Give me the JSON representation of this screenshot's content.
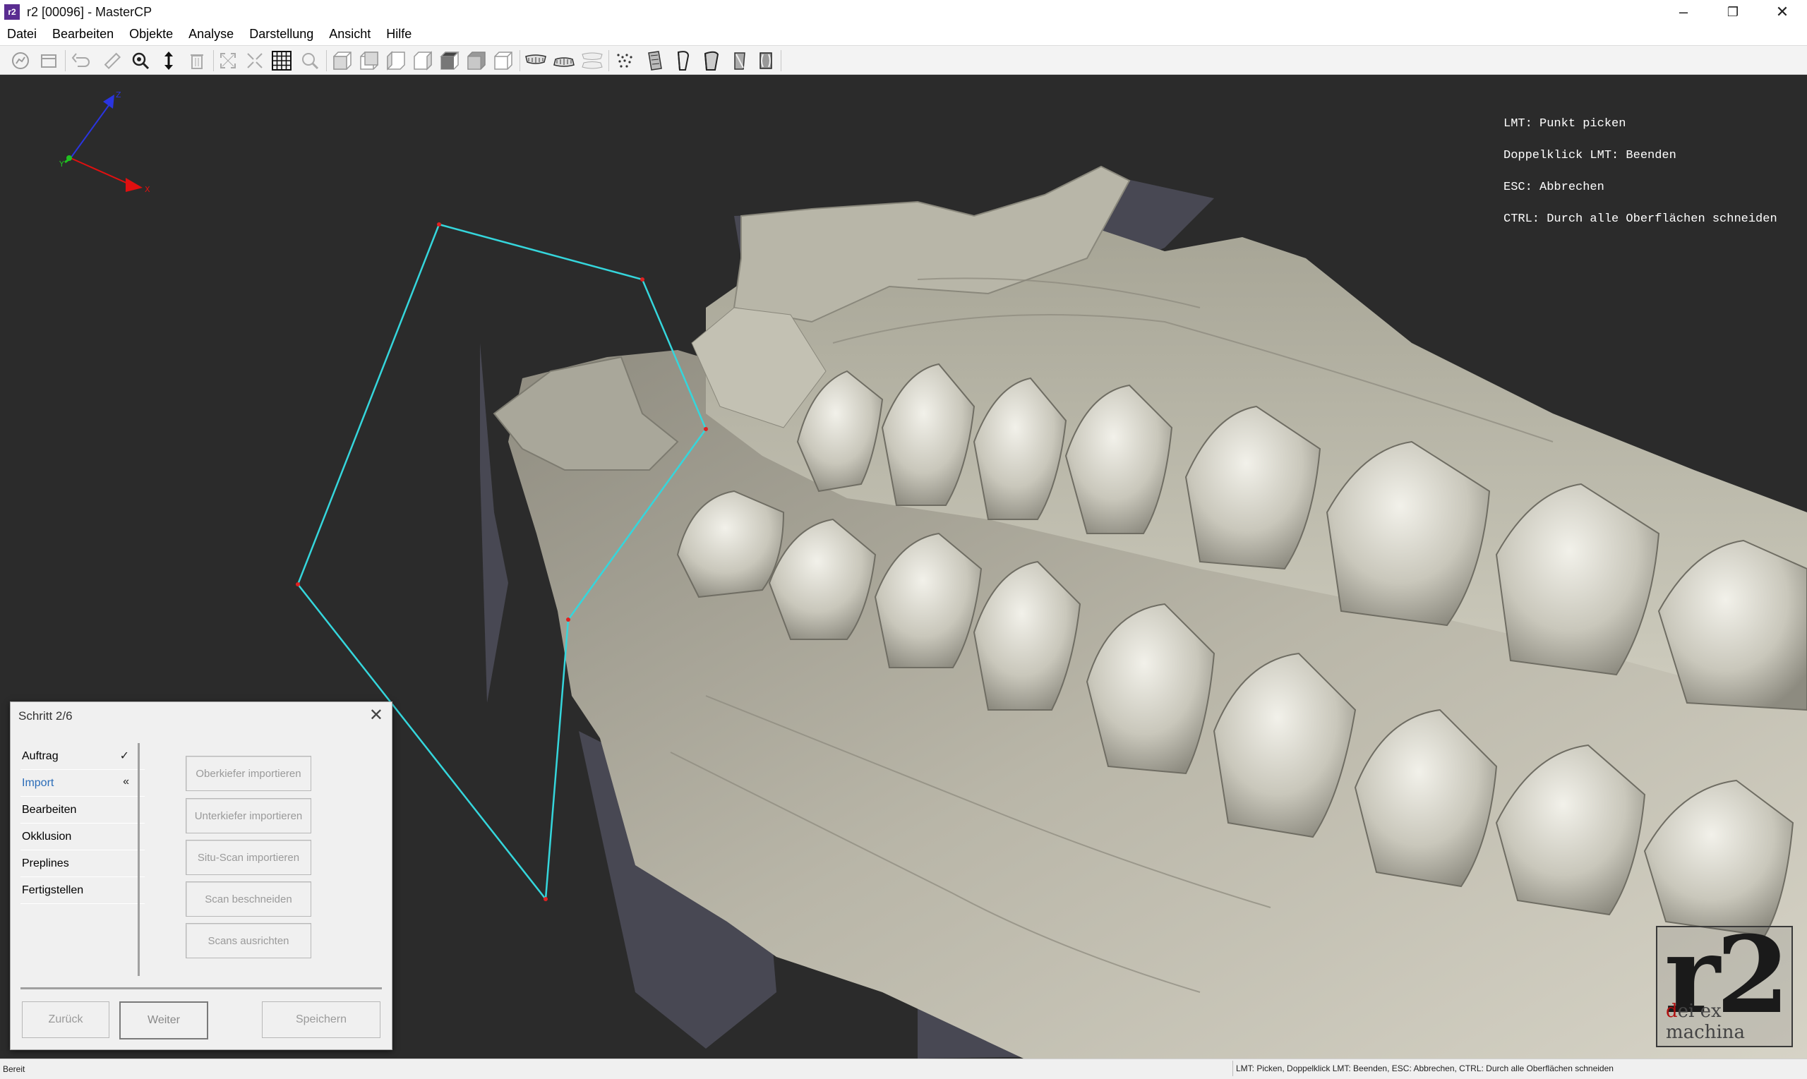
{
  "window": {
    "title": "r2 [00096] - MasterCP",
    "app_icon_text": "r2",
    "minimize_glyph": "–",
    "restore_glyph": "❐",
    "close_glyph": "✕"
  },
  "menu": [
    "Datei",
    "Bearbeiten",
    "Objekte",
    "Analyse",
    "Darstellung",
    "Ansicht",
    "Hilfe"
  ],
  "toolbar": {
    "icons": [
      "chart-icon",
      "box-icon",
      "undo-icon",
      "ruler-icon",
      "zoom-target-icon",
      "vertical-arrows-icon",
      "trash-icon",
      "expand-icon",
      "collapse-icon",
      "grid-icon",
      "magnifier-icon",
      "view-front-icon",
      "view-back-icon",
      "view-left-icon",
      "view-right-icon",
      "view-top-icon",
      "view-bottom-icon",
      "view-iso-icon",
      "upper-jaw-icon",
      "lower-jaw-icon",
      "both-jaws-icon",
      "points-icon",
      "die-1-icon",
      "die-2-icon",
      "die-3-icon",
      "die-4-icon",
      "die-5-icon"
    ]
  },
  "viewport": {
    "background": "#2b2b2b",
    "axis_labels": {
      "z": "Z",
      "x": "X",
      "y": "Y"
    },
    "hint_lines": [
      "LMT: Punkt picken",
      "Doppelklick LMT: Beenden",
      "ESC: Abbrechen",
      "CTRL: Durch alle Oberflächen schneiden"
    ],
    "polygon_color": "#35d6dc",
    "vertex_color": "#e02020"
  },
  "logo": {
    "main": "r2",
    "sub_red": "d",
    "sub_rest": "ei ex machina"
  },
  "dialog": {
    "title": "Schritt 2/6",
    "close_glyph": "✕",
    "steps": [
      {
        "label": "Auftrag",
        "mark": "✓",
        "active": false
      },
      {
        "label": "Import",
        "mark": "«",
        "active": true
      },
      {
        "label": "Bearbeiten",
        "mark": "",
        "active": false
      },
      {
        "label": "Okklusion",
        "mark": "",
        "active": false
      },
      {
        "label": "Preplines",
        "mark": "",
        "active": false
      },
      {
        "label": "Fertigstellen",
        "mark": "",
        "active": false
      }
    ],
    "actions": [
      "Oberkiefer importieren",
      "Unterkiefer importieren",
      "Situ-Scan importieren",
      "Scan beschneiden",
      "Scans ausrichten"
    ],
    "nav": {
      "back": "Zurück",
      "next": "Weiter",
      "save": "Speichern"
    }
  },
  "status": {
    "left": "Bereit",
    "right": "LMT: Picken, Doppelklick LMT: Beenden, ESC: Abbrechen, CTRL: Durch alle Oberflächen schneiden"
  }
}
